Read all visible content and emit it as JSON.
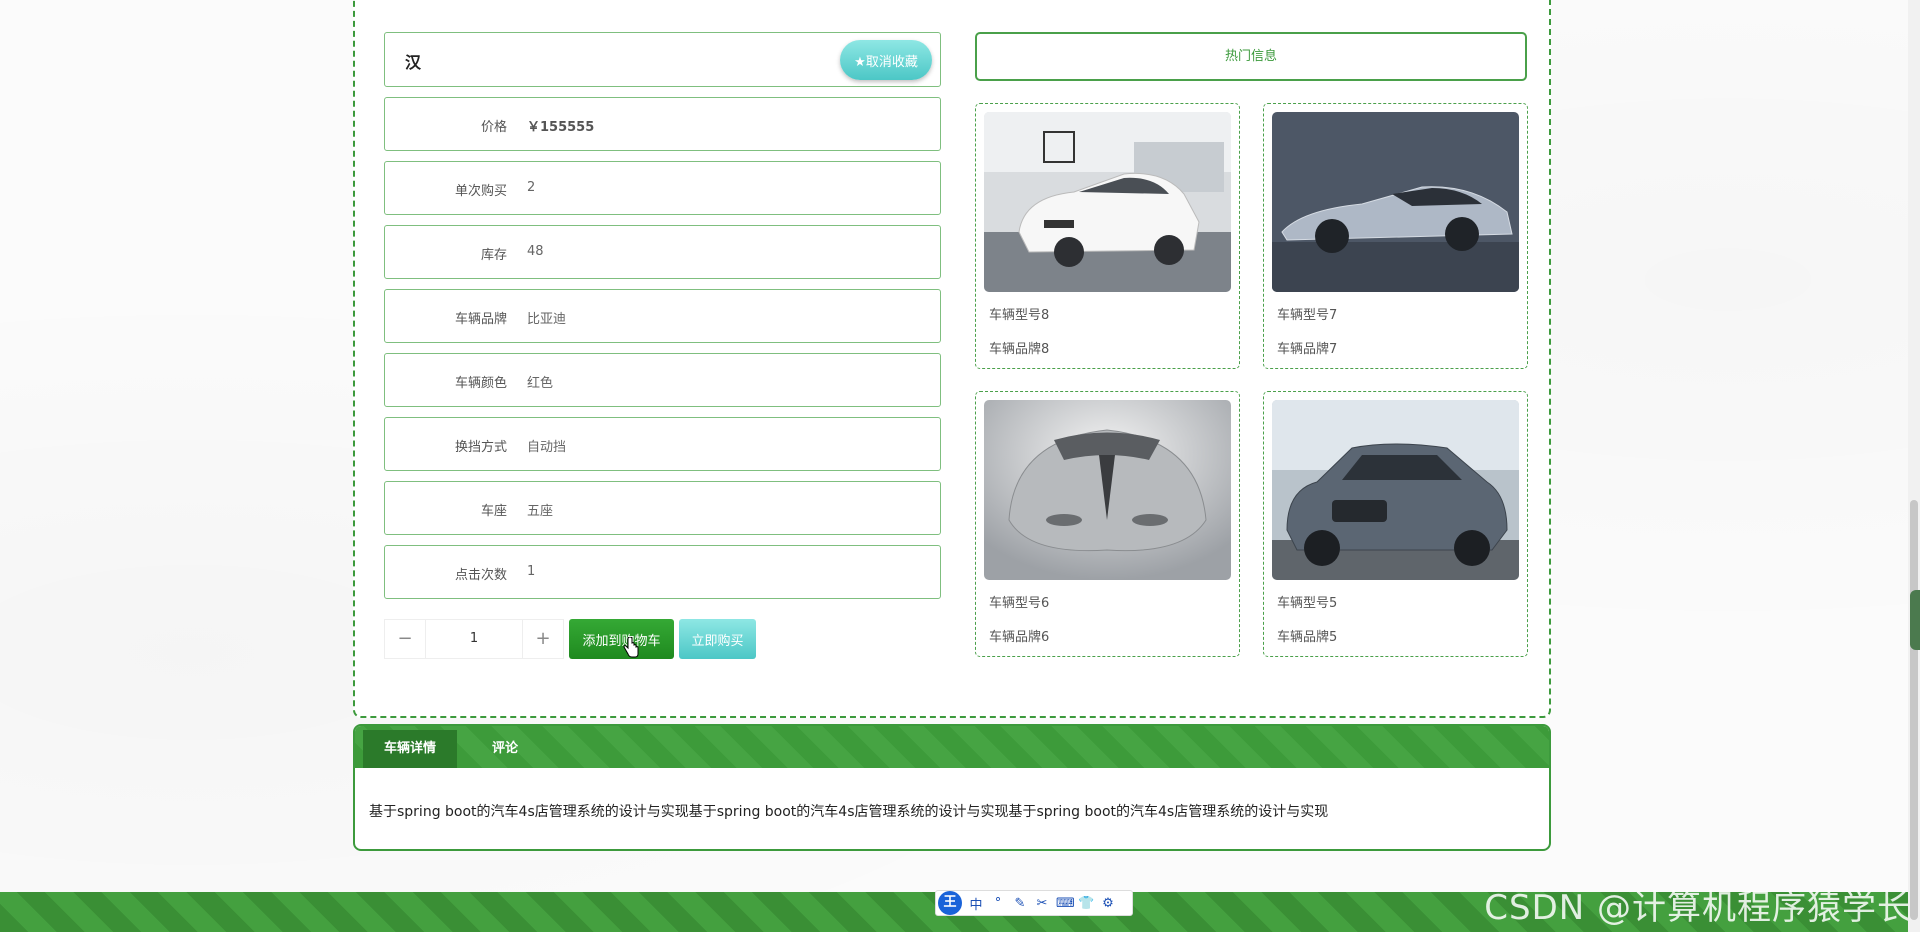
{
  "product": {
    "title": "汉",
    "favorite_label": "★取消收藏",
    "fields": [
      {
        "label": "价格",
        "value": "￥155555"
      },
      {
        "label": "单次购买",
        "value": "2"
      },
      {
        "label": "库存",
        "value": "48"
      },
      {
        "label": "车辆品牌",
        "value": "比亚迪"
      },
      {
        "label": "车辆颜色",
        "value": "红色"
      },
      {
        "label": "换挡方式",
        "value": "自动挡"
      },
      {
        "label": "车座",
        "value": "五座"
      },
      {
        "label": "点击次数",
        "value": "1"
      }
    ],
    "quantity": "1",
    "minus_symbol": "−",
    "plus_symbol": "+",
    "add_to_cart_label": "添加到购物车",
    "buy_now_label": "立即购买"
  },
  "hot": {
    "header": "热门信息",
    "cards": [
      {
        "model": "车辆型号8",
        "brand": "车辆品牌8"
      },
      {
        "model": "车辆型号7",
        "brand": "车辆品牌7"
      },
      {
        "model": "车辆型号6",
        "brand": "车辆品牌6"
      },
      {
        "model": "车辆型号5",
        "brand": "车辆品牌5"
      }
    ]
  },
  "detail": {
    "tabs": [
      {
        "label": "车辆详情"
      },
      {
        "label": "评论"
      }
    ],
    "text": "基于spring boot的汽车4s店管理系统的设计与实现基于spring boot的汽车4s店管理系统的设计与实现基于spring boot的汽车4s店管理系统的设计与实现"
  },
  "ime": {
    "logo": "王",
    "items": [
      "中",
      "°",
      "✎",
      "✂",
      "⌨",
      "👕",
      "⚙"
    ]
  },
  "watermark": "CSDN @计算机程序猿学长",
  "colors": {
    "accent": "#3c9a3c",
    "teal": "#4cc7c6"
  }
}
